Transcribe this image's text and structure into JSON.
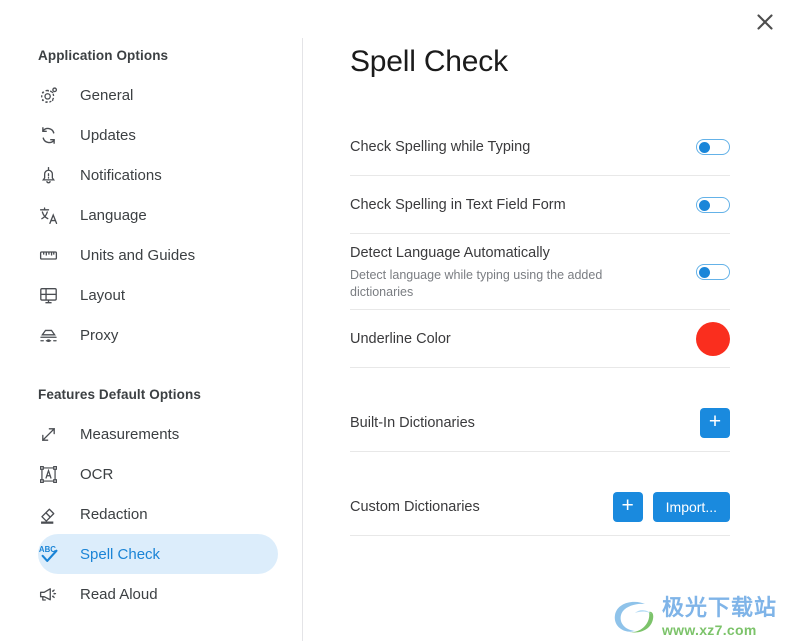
{
  "window": {
    "close_label": "×",
    "accent_blue": "#1a8ade",
    "active_pill_bg": "#dcedfb",
    "active_text": "#1a84d6"
  },
  "sidebar": {
    "sections": [
      {
        "header": "Application Options",
        "items": [
          {
            "label": "General",
            "icon": "gear-icon"
          },
          {
            "label": "Updates",
            "icon": "refresh-icon"
          },
          {
            "label": "Notifications",
            "icon": "bell-alert-icon"
          },
          {
            "label": "Language",
            "icon": "translate-icon"
          },
          {
            "label": "Units and Guides",
            "icon": "ruler-icon"
          },
          {
            "label": "Layout",
            "icon": "monitor-layout-icon"
          },
          {
            "label": "Proxy",
            "icon": "proxy-icon"
          }
        ]
      },
      {
        "header": "Features Default Options",
        "items": [
          {
            "label": "Measurements",
            "icon": "double-arrow-icon"
          },
          {
            "label": "OCR",
            "icon": "text-box-icon"
          },
          {
            "label": "Redaction",
            "icon": "eraser-icon"
          },
          {
            "label": "Spell Check",
            "icon": "abc-check-icon",
            "active": true
          },
          {
            "label": "Read Aloud",
            "icon": "megaphone-icon"
          }
        ]
      }
    ]
  },
  "main": {
    "title": "Spell Check",
    "rows": [
      {
        "label": "Check Spelling while Typing",
        "sub": "",
        "control": "toggle",
        "toggle_on": false
      },
      {
        "label": "Check Spelling in Text Field Form",
        "sub": "",
        "control": "toggle",
        "toggle_on": false
      },
      {
        "label": "Detect Language Automatically",
        "sub": "Detect language while typing using the added dictionaries",
        "control": "toggle",
        "toggle_on": false
      },
      {
        "label": "Underline Color",
        "sub": "",
        "control": "swatch",
        "swatch_color": "#fa2e1e"
      },
      {
        "label": "Built-In Dictionaries",
        "sub": "",
        "control": "buttons",
        "buttons": [
          {
            "label": "+",
            "kind": "plus",
            "name": "add-builtin-dictionary-button"
          }
        ]
      },
      {
        "label": "Custom Dictionaries",
        "sub": "",
        "control": "buttons",
        "buttons": [
          {
            "label": "+",
            "kind": "plus",
            "name": "add-custom-dictionary-button"
          },
          {
            "label": "Import...",
            "kind": "text",
            "name": "import-dictionary-button"
          }
        ]
      }
    ]
  },
  "watermark": {
    "cn": "极光下载站",
    "url": "www.xz7.com"
  }
}
